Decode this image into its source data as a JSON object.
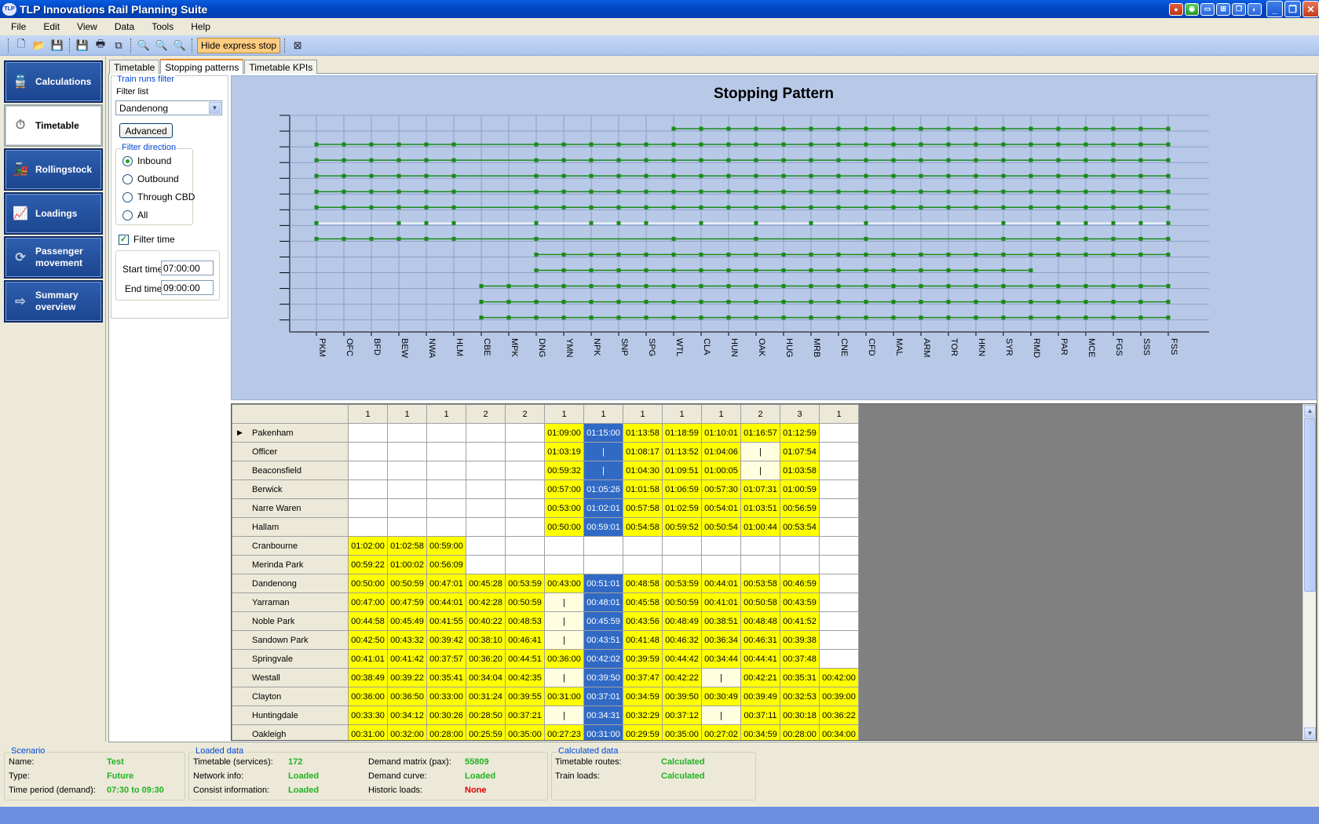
{
  "window": {
    "title": "TLP Innovations Rail Planning Suite",
    "icon_label": "TLP"
  },
  "menu": [
    "File",
    "Edit",
    "View",
    "Data",
    "Tools",
    "Help"
  ],
  "toolbar": {
    "hide_express_label": "Hide express stop"
  },
  "nav": [
    {
      "label": "Calculations",
      "icon": "train-icon",
      "active": false
    },
    {
      "label": "Timetable",
      "icon": "stopwatch-icon",
      "active": true
    },
    {
      "label": "Rollingstock",
      "icon": "locomotive-icon",
      "active": false
    },
    {
      "label": "Loadings",
      "icon": "line-chart-icon",
      "active": false
    },
    {
      "label": "Passenger movement",
      "icon": "refresh-arrows-icon",
      "active": false
    },
    {
      "label": "Summary overview",
      "icon": "arrow-right-icon",
      "active": false
    }
  ],
  "tabs": [
    {
      "label": "Timetable",
      "active": false
    },
    {
      "label": "Stopping patterns",
      "active": true
    },
    {
      "label": "Timetable KPIs",
      "active": false
    }
  ],
  "filter": {
    "group_title": "Train runs filter",
    "list_label": "Filter list",
    "list_value": "Dandenong",
    "advanced_label": "Advanced",
    "direction_title": "Filter direction",
    "directions": [
      {
        "label": "Inbound",
        "checked": true
      },
      {
        "label": "Outbound",
        "checked": false
      },
      {
        "label": "Through CBD",
        "checked": false
      },
      {
        "label": "All",
        "checked": false
      }
    ],
    "filter_time_label": "Filter time",
    "filter_time_checked": true,
    "start_label": "Start time",
    "start_value": "07:00:00",
    "end_label": "End time",
    "end_value": "09:00:00"
  },
  "chart_data": {
    "type": "scatter",
    "title": "Stopping Pattern",
    "categories": [
      "PKM",
      "OFC",
      "BFD",
      "BEW",
      "NWA",
      "HLM",
      "CBE",
      "MPK",
      "DNG",
      "YMN",
      "NPK",
      "SNP",
      "SPG",
      "WTL",
      "CLA",
      "HUN",
      "OAK",
      "HUG",
      "MRB",
      "CNE",
      "CFD",
      "MAL",
      "ARM",
      "TOR",
      "HKN",
      "SYR",
      "RMD",
      "PAR",
      "MCE",
      "FGS",
      "SSS",
      "FSS"
    ],
    "grid": true,
    "runs": [
      {
        "stops": [
          13,
          14,
          15,
          16,
          17,
          18,
          19,
          20,
          21,
          22,
          23,
          24,
          25,
          26,
          27,
          28,
          29,
          30,
          31
        ]
      },
      {
        "stops": [
          0,
          1,
          2,
          3,
          4,
          5,
          8,
          9,
          10,
          11,
          12,
          13,
          14,
          15,
          16,
          17,
          18,
          19,
          20,
          21,
          22,
          23,
          24,
          25,
          26,
          27,
          28,
          29,
          30,
          31
        ]
      },
      {
        "stops": [
          0,
          1,
          2,
          3,
          4,
          5,
          8,
          9,
          10,
          11,
          12,
          13,
          14,
          15,
          16,
          17,
          18,
          19,
          20,
          21,
          22,
          23,
          24,
          25,
          26,
          27,
          28,
          29,
          30,
          31
        ]
      },
      {
        "stops": [
          0,
          1,
          2,
          3,
          4,
          5,
          8,
          9,
          10,
          11,
          12,
          13,
          14,
          15,
          16,
          17,
          18,
          19,
          20,
          21,
          22,
          23,
          24,
          25,
          26,
          27,
          28,
          29,
          30,
          31
        ]
      },
      {
        "stops": [
          0,
          1,
          2,
          3,
          4,
          5,
          8,
          9,
          10,
          11,
          12,
          13,
          14,
          15,
          16,
          17,
          18,
          19,
          20,
          21,
          22,
          23,
          24,
          25,
          26,
          27,
          28,
          29,
          30,
          31
        ]
      },
      {
        "stops": [
          0,
          1,
          2,
          3,
          4,
          5,
          8,
          9,
          10,
          11,
          12,
          13,
          14,
          15,
          16,
          17,
          18,
          19,
          20,
          21,
          22,
          23,
          24,
          25,
          26,
          27,
          28,
          29,
          30,
          31
        ]
      },
      {
        "stops": [
          0,
          3,
          4,
          5,
          8,
          10,
          11,
          12,
          14,
          16,
          18,
          20,
          25,
          27,
          28,
          29,
          30,
          31
        ],
        "highlight": true
      },
      {
        "stops": [
          0,
          1,
          2,
          3,
          4,
          5,
          8,
          13,
          16,
          20,
          25,
          27,
          28,
          29,
          30,
          31
        ]
      },
      {
        "stops": [
          8,
          9,
          10,
          11,
          12,
          13,
          14,
          15,
          16,
          17,
          18,
          19,
          20,
          21,
          22,
          23,
          24,
          25,
          26,
          27,
          28,
          29,
          30,
          31
        ]
      },
      {
        "stops": [
          8,
          9,
          10,
          11,
          12,
          13,
          14,
          15,
          16,
          17,
          18,
          19,
          20,
          21,
          22,
          23,
          24,
          25,
          26
        ]
      },
      {
        "stops": [
          6,
          7,
          8,
          9,
          10,
          11,
          12,
          13,
          14,
          15,
          16,
          17,
          18,
          19,
          20,
          21,
          22,
          23,
          24,
          25,
          26,
          27,
          28,
          29,
          30,
          31
        ]
      },
      {
        "stops": [
          6,
          7,
          8,
          9,
          10,
          11,
          12,
          13,
          14,
          15,
          16,
          17,
          18,
          19,
          20,
          21,
          22,
          23,
          24,
          25,
          26,
          27,
          28,
          29,
          30,
          31
        ]
      },
      {
        "stops": [
          6,
          7,
          8,
          9,
          10,
          11,
          12,
          13,
          14,
          15,
          16,
          17,
          18,
          19,
          20,
          21,
          22,
          23,
          24,
          25,
          26,
          27,
          28,
          29,
          30,
          31
        ]
      }
    ]
  },
  "grid": {
    "headers": [
      "1",
      "1",
      "1",
      "2",
      "2",
      "1",
      "1",
      "1",
      "1",
      "1",
      "2",
      "3",
      "1"
    ],
    "selected_row": 0,
    "rows": [
      {
        "station": "Pakenham",
        "cells": [
          "",
          "",
          "",
          "",
          "",
          "01:09:00",
          "01:15:00",
          "01:13:58",
          "01:18:59",
          "01:10:01",
          "01:16:57",
          "01:12:59",
          ""
        ]
      },
      {
        "station": "Officer",
        "cells": [
          "",
          "",
          "",
          "",
          "",
          "01:03:19",
          "|",
          "01:08:17",
          "01:13:52",
          "01:04:06",
          "|",
          "01:07:54",
          ""
        ]
      },
      {
        "station": "Beaconsfield",
        "cells": [
          "",
          "",
          "",
          "",
          "",
          "00:59:32",
          "|",
          "01:04:30",
          "01:09:51",
          "01:00:05",
          "|",
          "01:03:58",
          ""
        ]
      },
      {
        "station": "Berwick",
        "cells": [
          "",
          "",
          "",
          "",
          "",
          "00:57:00",
          "01:05:26",
          "01:01:58",
          "01:06:59",
          "00:57:30",
          "01:07:31",
          "01:00:59",
          ""
        ]
      },
      {
        "station": "Narre Waren",
        "cells": [
          "",
          "",
          "",
          "",
          "",
          "00:53:00",
          "01:02:01",
          "00:57:58",
          "01:02:59",
          "00:54:01",
          "01:03:51",
          "00:56:59",
          ""
        ]
      },
      {
        "station": "Hallam",
        "cells": [
          "",
          "",
          "",
          "",
          "",
          "00:50:00",
          "00:59:01",
          "00:54:58",
          "00:59:52",
          "00:50:54",
          "01:00:44",
          "00:53:54",
          ""
        ]
      },
      {
        "station": "Cranbourne",
        "cells": [
          "01:02:00",
          "01:02:58",
          "00:59:00",
          "",
          "",
          "",
          "",
          "",
          "",
          "",
          "",
          "",
          ""
        ]
      },
      {
        "station": "Merinda Park",
        "cells": [
          "00:59:22",
          "01:00:02",
          "00:56:09",
          "",
          "",
          "",
          "",
          "",
          "",
          "",
          "",
          "",
          ""
        ]
      },
      {
        "station": "Dandenong",
        "cells": [
          "00:50:00",
          "00:50:59",
          "00:47:01",
          "00:45:28",
          "00:53:59",
          "00:43:00",
          "00:51:01",
          "00:48:58",
          "00:53:59",
          "00:44:01",
          "00:53:58",
          "00:46:59",
          ""
        ]
      },
      {
        "station": "Yarraman",
        "cells": [
          "00:47:00",
          "00:47:59",
          "00:44:01",
          "00:42:28",
          "00:50:59",
          "|",
          "00:48:01",
          "00:45:58",
          "00:50:59",
          "00:41:01",
          "00:50:58",
          "00:43:59",
          ""
        ]
      },
      {
        "station": "Noble Park",
        "cells": [
          "00:44:58",
          "00:45:49",
          "00:41:55",
          "00:40:22",
          "00:48:53",
          "|",
          "00:45:59",
          "00:43:56",
          "00:48:49",
          "00:38:51",
          "00:48:48",
          "00:41:52",
          ""
        ]
      },
      {
        "station": "Sandown Park",
        "cells": [
          "00:42:50",
          "00:43:32",
          "00:39:42",
          "00:38:10",
          "00:46:41",
          "|",
          "00:43:51",
          "00:41:48",
          "00:46:32",
          "00:36:34",
          "00:46:31",
          "00:39:38",
          ""
        ]
      },
      {
        "station": "Springvale",
        "cells": [
          "00:41:01",
          "00:41:42",
          "00:37:57",
          "00:36:20",
          "00:44:51",
          "00:36:00",
          "00:42:02",
          "00:39:59",
          "00:44:42",
          "00:34:44",
          "00:44:41",
          "00:37:48",
          ""
        ]
      },
      {
        "station": "Westall",
        "cells": [
          "00:38:49",
          "00:39:22",
          "00:35:41",
          "00:34:04",
          "00:42:35",
          "|",
          "00:39:50",
          "00:37:47",
          "00:42:22",
          "|",
          "00:42:21",
          "00:35:31",
          "00:42:00"
        ]
      },
      {
        "station": "Clayton",
        "cells": [
          "00:36:00",
          "00:36:50",
          "00:33:00",
          "00:31:24",
          "00:39:55",
          "00:31:00",
          "00:37:01",
          "00:34:59",
          "00:39:50",
          "00:30:49",
          "00:39:49",
          "00:32:53",
          "00:39:00"
        ]
      },
      {
        "station": "Huntingdale",
        "cells": [
          "00:33:30",
          "00:34:12",
          "00:30:26",
          "00:28:50",
          "00:37:21",
          "|",
          "00:34:31",
          "00:32:29",
          "00:37:12",
          "|",
          "00:37:11",
          "00:30:18",
          "00:36:22"
        ]
      },
      {
        "station": "Oakleigh",
        "cells": [
          "00:31:00",
          "00:32:00",
          "00:28:00",
          "00:25:59",
          "00:35:00",
          "00:27:23",
          "00:31:00",
          "00:29:59",
          "00:35:00",
          "00:27:02",
          "00:34:59",
          "00:28:00",
          "00:34:00"
        ]
      }
    ]
  },
  "status": {
    "scenario": {
      "title": "Scenario",
      "rows": [
        {
          "label": "Name:",
          "value": "Test"
        },
        {
          "label": "Type:",
          "value": "Future"
        },
        {
          "label": "Time period (demand):",
          "value": "07:30 to 09:30"
        }
      ]
    },
    "loaded": {
      "title": "Loaded data",
      "left": [
        {
          "label": "Timetable (services):",
          "value": "172"
        },
        {
          "label": "Network info:",
          "value": "Loaded"
        },
        {
          "label": "Consist information:",
          "value": "Loaded"
        }
      ],
      "right": [
        {
          "label": "Demand matrix (pax):",
          "value": "55809",
          "color": "green"
        },
        {
          "label": "Demand curve:",
          "value": "Loaded",
          "color": "green"
        },
        {
          "label": "Historic loads:",
          "value": "None",
          "color": "red"
        }
      ]
    },
    "calculated": {
      "title": "Calculated data",
      "rows": [
        {
          "label": "Timetable routes:",
          "value": "Calculated"
        },
        {
          "label": "Train loads:",
          "value": "Calculated"
        }
      ]
    }
  },
  "colors": {
    "cell_yellow": "#ffff00",
    "cell_blue": "#316ac5",
    "chart_bg": "#b8c9e8",
    "series_green": "#1a8a1a",
    "highlight_line": "#ffffff",
    "status_green": "#22b222",
    "status_red": "#e00000"
  }
}
